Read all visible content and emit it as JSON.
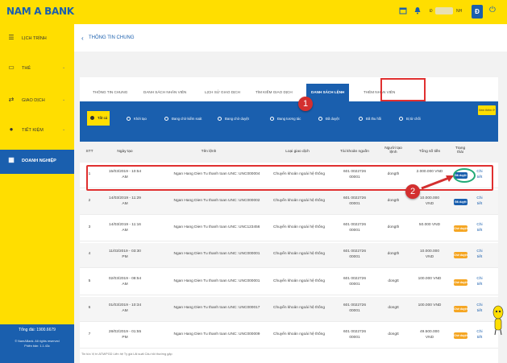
{
  "brand": {
    "logo": "NAM A BANK"
  },
  "header": {
    "user_initial": "Đ",
    "user_name_left": "Đ",
    "user_name_right": "NH",
    "chevron": "⌄"
  },
  "sidebar": {
    "items": [
      {
        "label": "LỊCH TRÌNH",
        "icon": "list-icon",
        "has_chevron": false
      },
      {
        "label": "THẺ",
        "icon": "card-icon",
        "has_chevron": true
      },
      {
        "label": "GIAO DỊCH",
        "icon": "transaction-icon",
        "has_chevron": true
      },
      {
        "label": "TIẾT KIỆM",
        "icon": "piggy-bank-icon",
        "has_chevron": true
      },
      {
        "label": "DOANH NGHIỆP",
        "icon": "building-icon",
        "has_chevron": false
      }
    ],
    "hotline": "Tổng đài: 1900.6679",
    "copyright_line1": "© NamABank. All rights reserved",
    "copyright_line2": "Phiên bản: 1.1.43c"
  },
  "page": {
    "back_arrow": "‹",
    "title": "THÔNG TIN CHUNG"
  },
  "tabs": [
    {
      "label": "THÔNG TIN CHUNG"
    },
    {
      "label": "DANH SÁCH NHÂN VIÊN"
    },
    {
      "label": "LỊCH SỬ GIAO DỊCH"
    },
    {
      "label": "TÌM KIẾM GIAO DỊCH"
    },
    {
      "label": "DANH SÁCH LỆNH",
      "active": true
    },
    {
      "label": "THÊM NHÂN VIÊN"
    }
  ],
  "filters": [
    {
      "label": "Tất cả",
      "selected": true
    },
    {
      "label": "Khởi tạo"
    },
    {
      "label": "Đang chờ kiểm soát"
    },
    {
      "label": "Đang chờ duyệt"
    },
    {
      "label": "Đang tương tác"
    },
    {
      "label": "Đã duyệt"
    },
    {
      "label": "Đã thu hồi"
    },
    {
      "label": "Bị từ chối"
    }
  ],
  "more_button": "Xem thêm ⟳",
  "table": {
    "headers": {
      "stt": "STT",
      "date": "Ngày tạo",
      "name": "Tên lệnh",
      "type": "Loại giao dịch",
      "account": "Tài khoản nguồn",
      "creator_line1": "Người tạo",
      "creator_line2": "lệnh",
      "amount": "Tổng số tiền",
      "status_line1": "Trạng",
      "status_line2": "thái"
    },
    "rows": [
      {
        "stt": "1",
        "date1": "15/03/2019 - 10:54",
        "date2": "AM",
        "name": "Ngan Hang Dien Tu thanh toan UNC: UNC000004",
        "type": "Chuyển khoản ngoài hệ thống",
        "acc1": "601 0022726",
        "acc2": "00001",
        "creator": "dongth",
        "amount1": "2.000.000 VND",
        "amount2": "",
        "status": "Đã duyệt",
        "status_kind": "approved",
        "detail1": "Chi",
        "detail2": "tiết"
      },
      {
        "stt": "2",
        "date1": "14/03/2019 - 11:29",
        "date2": "AM",
        "name": "Ngan Hang Dien Tu thanh toan UNC: UNC000002",
        "type": "Chuyển khoản ngoài hệ thống",
        "acc1": "601 0022726",
        "acc2": "00001",
        "creator": "dongth",
        "amount1": "10.000.000",
        "amount2": "VND",
        "status": "Đã duyệt",
        "status_kind": "approved",
        "detail1": "Chi",
        "detail2": "tiết"
      },
      {
        "stt": "3",
        "date1": "14/03/2019 - 11:16",
        "date2": "AM",
        "name": "Ngan Hang Dien Tu thanh toan UNC: UNC123456",
        "type": "Chuyển khoản ngoài hệ thống",
        "acc1": "601 0022726",
        "acc2": "00001",
        "creator": "dongth",
        "amount1": "50.000 VND",
        "amount2": "",
        "status": "Chờ duyệt",
        "status_kind": "pending",
        "detail1": "Chi",
        "detail2": "tiết"
      },
      {
        "stt": "4",
        "date1": "11/03/2019 - 03:30",
        "date2": "PM",
        "name": "Ngan Hang Dien Tu thanh toan UNC: UNC000001",
        "type": "Chuyển khoản ngoài hệ thống",
        "acc1": "601 0022726",
        "acc2": "00001",
        "creator": "dongth",
        "amount1": "10.000.000",
        "amount2": "VND",
        "status": "Chờ duyệt",
        "status_kind": "pending",
        "detail1": "Chi",
        "detail2": "tiết"
      },
      {
        "stt": "5",
        "date1": "02/03/2019 - 08:54",
        "date2": "AM",
        "name": "Ngan Hang Dien Tu thanh toan UNC: UNC000001",
        "type": "Chuyển khoản ngoài hệ thống",
        "acc1": "601 0022726",
        "acc2": "00001",
        "creator": "dongtt",
        "amount1": "100.000 VND",
        "amount2": "",
        "status": "Chờ duyệt",
        "status_kind": "pending",
        "detail1": "Chi",
        "detail2": "tiết"
      },
      {
        "stt": "6",
        "date1": "01/03/2019 - 10:34",
        "date2": "AM",
        "name": "Ngan Hang Dien Tu thanh toan UNC: UNC000017",
        "type": "Chuyển khoản ngoài hệ thống",
        "acc1": "601 0022726",
        "acc2": "00001",
        "creator": "dongtt",
        "amount1": "100.000 VND",
        "amount2": "",
        "status": "Chờ duyệt",
        "status_kind": "pending",
        "detail1": "Chi",
        "detail2": "tiết"
      },
      {
        "stt": "7",
        "date1": "28/02/2019 - 01:55",
        "date2": "PM",
        "name": "Ngan Hang Dien Tu thanh toan UNC: UNC000009",
        "type": "Chuyển khoản ngoài hệ thống",
        "acc1": "601 0022726",
        "acc2": "00001",
        "creator": "dongtt",
        "amount1": "49.500.000",
        "amount2": "VND",
        "status": "Chờ duyệt",
        "status_kind": "pending",
        "detail1": "Chi",
        "detail2": "tiết"
      }
    ]
  },
  "footer_links": "Tin tức    Vị trí ATM/PGD    Liên hệ    Tỷ giá    Lãi suất    Câu hỏi thường gặp",
  "annotations": {
    "step1": "1",
    "step2": "2"
  },
  "colors": {
    "brand_yellow": "#ffde00",
    "brand_blue": "#1a5fae",
    "approved": "#1a5fae",
    "pending": "#f5a623",
    "annotation_red": "#d32f2f"
  }
}
